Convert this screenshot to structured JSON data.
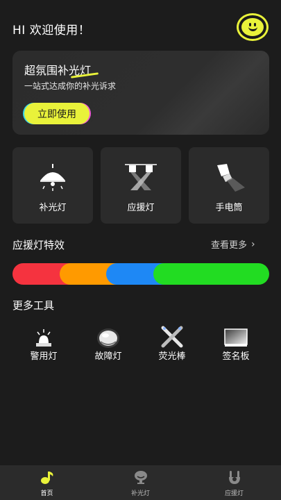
{
  "header": {
    "greeting": "HI 欢迎使用！"
  },
  "banner": {
    "title": "超氛围补光灯",
    "subtitle": "一站式达成你的补光诉求",
    "button_label": "立即使用"
  },
  "tiles": [
    {
      "label": "补光灯",
      "icon": "ceiling-lamp-icon"
    },
    {
      "label": "应援灯",
      "icon": "stage-spotlight-icon"
    },
    {
      "label": "手电筒",
      "icon": "flashlight-icon"
    }
  ],
  "effects_section": {
    "title": "应援灯特效",
    "more_label": "查看更多",
    "segments": [
      {
        "color": "#f5333f"
      },
      {
        "color": "#ff9a00"
      },
      {
        "color": "#1e88f5"
      },
      {
        "color": "#22dc22"
      }
    ]
  },
  "tools_section": {
    "title": "更多工具",
    "items": [
      {
        "label": "警用灯",
        "icon": "police-light-icon"
      },
      {
        "label": "故障灯",
        "icon": "warning-lamp-icon"
      },
      {
        "label": "荧光棒",
        "icon": "glow-stick-icon"
      },
      {
        "label": "签名板",
        "icon": "signature-board-icon"
      }
    ]
  },
  "tabbar": {
    "tabs": [
      {
        "label": "首页",
        "icon": "home-note-icon",
        "active": true
      },
      {
        "label": "补光灯",
        "icon": "fill-light-icon",
        "active": false
      },
      {
        "label": "应援灯",
        "icon": "cheer-hand-icon",
        "active": false
      }
    ]
  },
  "colors": {
    "accent": "#e9f23a",
    "background": "#1c1c1c",
    "card": "#2b2b2b"
  }
}
